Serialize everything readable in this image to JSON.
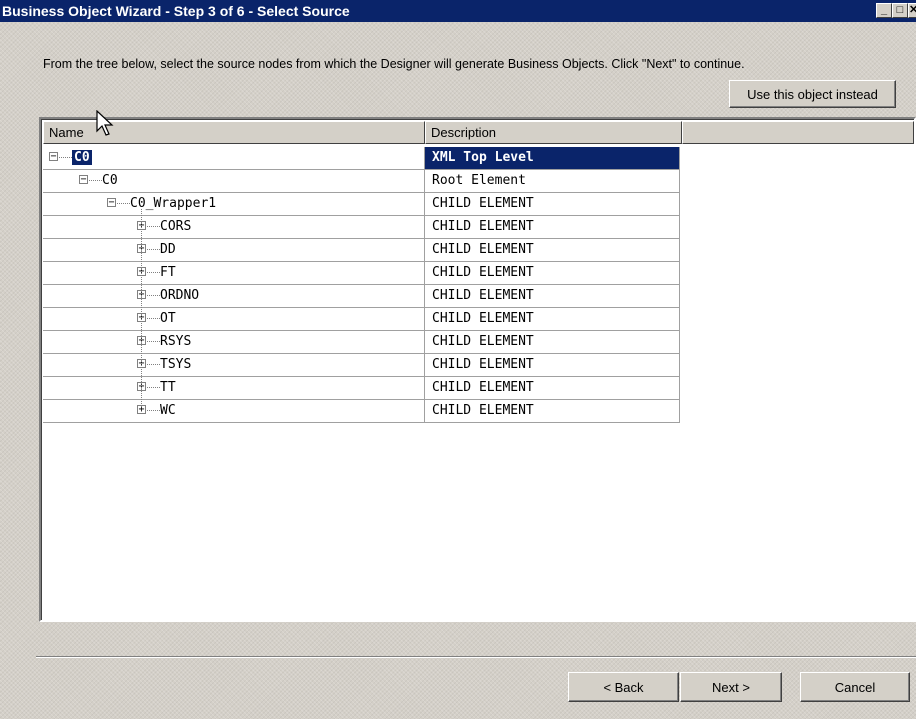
{
  "window": {
    "title": "Business Object Wizard - Step 3 of 6 - Select Source",
    "buttons": {
      "minimize": "_",
      "maximize": "□",
      "close": "✕"
    }
  },
  "instructions": "From the tree below, select the source nodes from which the Designer will generate Business Objects. Click \"Next\" to continue.",
  "use_object_button": "Use this object instead",
  "tree": {
    "columns": {
      "name": "Name",
      "description": "Description"
    },
    "rows": [
      {
        "name": "C0",
        "description": "XML Top Level",
        "selected": true,
        "expander": "minus",
        "level": 0
      },
      {
        "name": "C0",
        "description": "Root Element",
        "expander": "minus",
        "level": 1
      },
      {
        "name": "C0_Wrapper1",
        "description": "CHILD ELEMENT",
        "expander": "minus",
        "level": 2
      },
      {
        "name": "CORS",
        "description": "CHILD ELEMENT",
        "expander": "plus",
        "level": 3
      },
      {
        "name": "DD",
        "description": "CHILD ELEMENT",
        "expander": "plus",
        "level": 3
      },
      {
        "name": "FT",
        "description": "CHILD ELEMENT",
        "expander": "plus",
        "level": 3
      },
      {
        "name": "ORDNO",
        "description": "CHILD ELEMENT",
        "expander": "plus",
        "level": 3
      },
      {
        "name": "OT",
        "description": "CHILD ELEMENT",
        "expander": "plus",
        "level": 3
      },
      {
        "name": "RSYS",
        "description": "CHILD ELEMENT",
        "expander": "plus",
        "level": 3
      },
      {
        "name": "TSYS",
        "description": "CHILD ELEMENT",
        "expander": "plus",
        "level": 3
      },
      {
        "name": "TT",
        "description": "CHILD ELEMENT",
        "expander": "plus",
        "level": 3
      },
      {
        "name": "WC",
        "description": "CHILD ELEMENT",
        "expander": "plus",
        "level": 3
      }
    ]
  },
  "footer": {
    "back_label": "< Back",
    "next_label": "Next >",
    "cancel_label": "Cancel"
  },
  "colors": {
    "titlebar": "#0a246a",
    "selection": "#0a246a",
    "dialog_bg": "#d4d0c8"
  },
  "icons": {
    "cursor": "arrow-cursor-icon",
    "expand": "plus-box-icon",
    "collapse": "minus-box-icon"
  }
}
